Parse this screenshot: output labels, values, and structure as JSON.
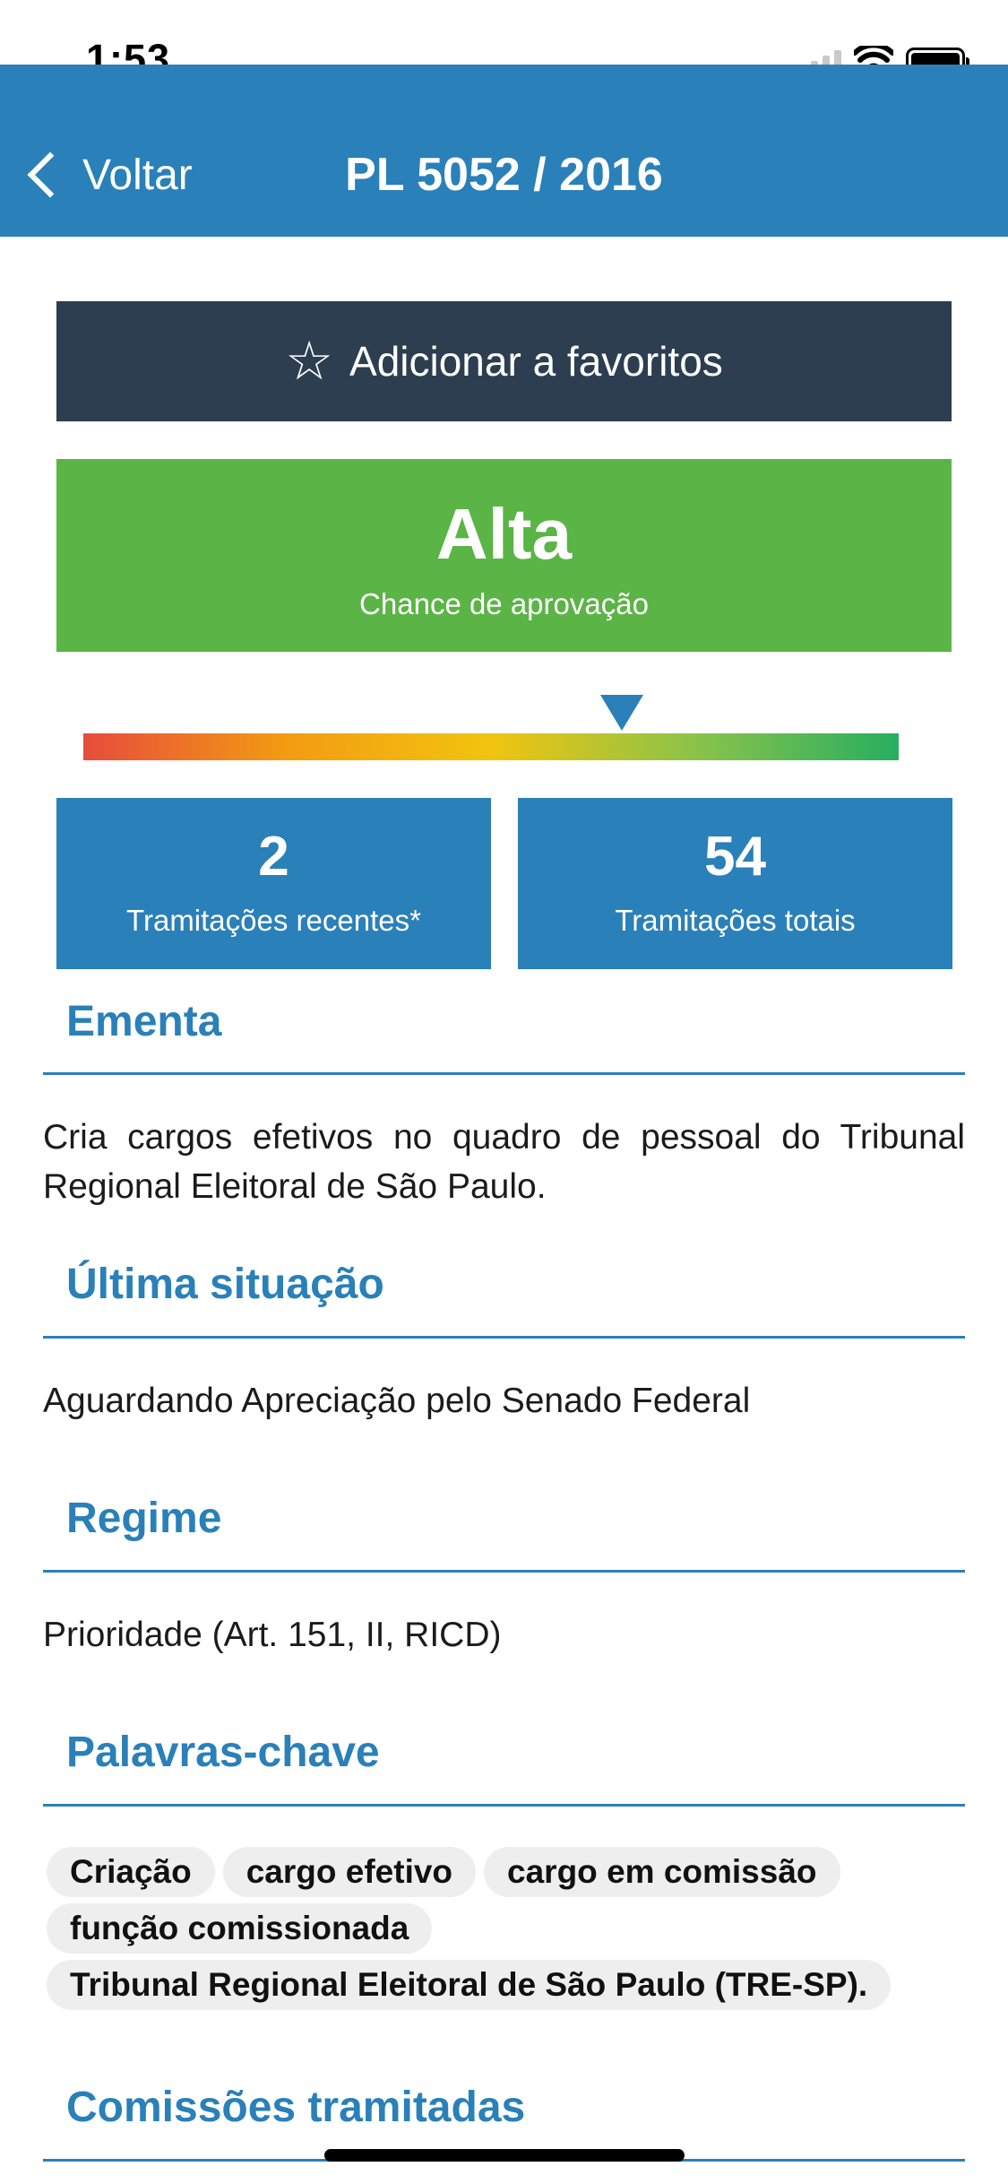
{
  "status_bar": {
    "time": "1:53"
  },
  "nav": {
    "back_label": "Voltar",
    "title": "PL 5052 / 2016"
  },
  "favorite_button": {
    "icon": "star-outline-icon",
    "label": "Adicionar a favoritos"
  },
  "approval": {
    "value": "Alta",
    "caption": "Chance de aprovação",
    "color": "#5bb446",
    "gauge_level_fraction": 0.66
  },
  "stats": [
    {
      "value": "2",
      "label": "Tramitações recentes*"
    },
    {
      "value": "54",
      "label": "Tramitações totais"
    }
  ],
  "sections": {
    "ementa": {
      "title": "Ementa",
      "text": "Cria cargos efetivos no quadro de pessoal do Tribunal Regional Eleitoral de São Paulo."
    },
    "ultima_situacao": {
      "title": "Última situação",
      "text": "Aguardando Apreciação pelo Senado Federal"
    },
    "regime": {
      "title": "Regime",
      "text": "Prioridade (Art. 151, II, RICD)"
    },
    "palavras_chave": {
      "title": "Palavras-chave",
      "tags": [
        "Criação",
        "cargo efetivo",
        "cargo em comissão",
        "função comissionada",
        "Tribunal Regional Eleitoral de São Paulo (TRE-SP)."
      ]
    },
    "comissoes": {
      "title": "Comissões tramitadas"
    }
  },
  "colors": {
    "primary": "#2a80b9",
    "dark": "#2c3e50",
    "tag_bg": "#eeeeee"
  }
}
